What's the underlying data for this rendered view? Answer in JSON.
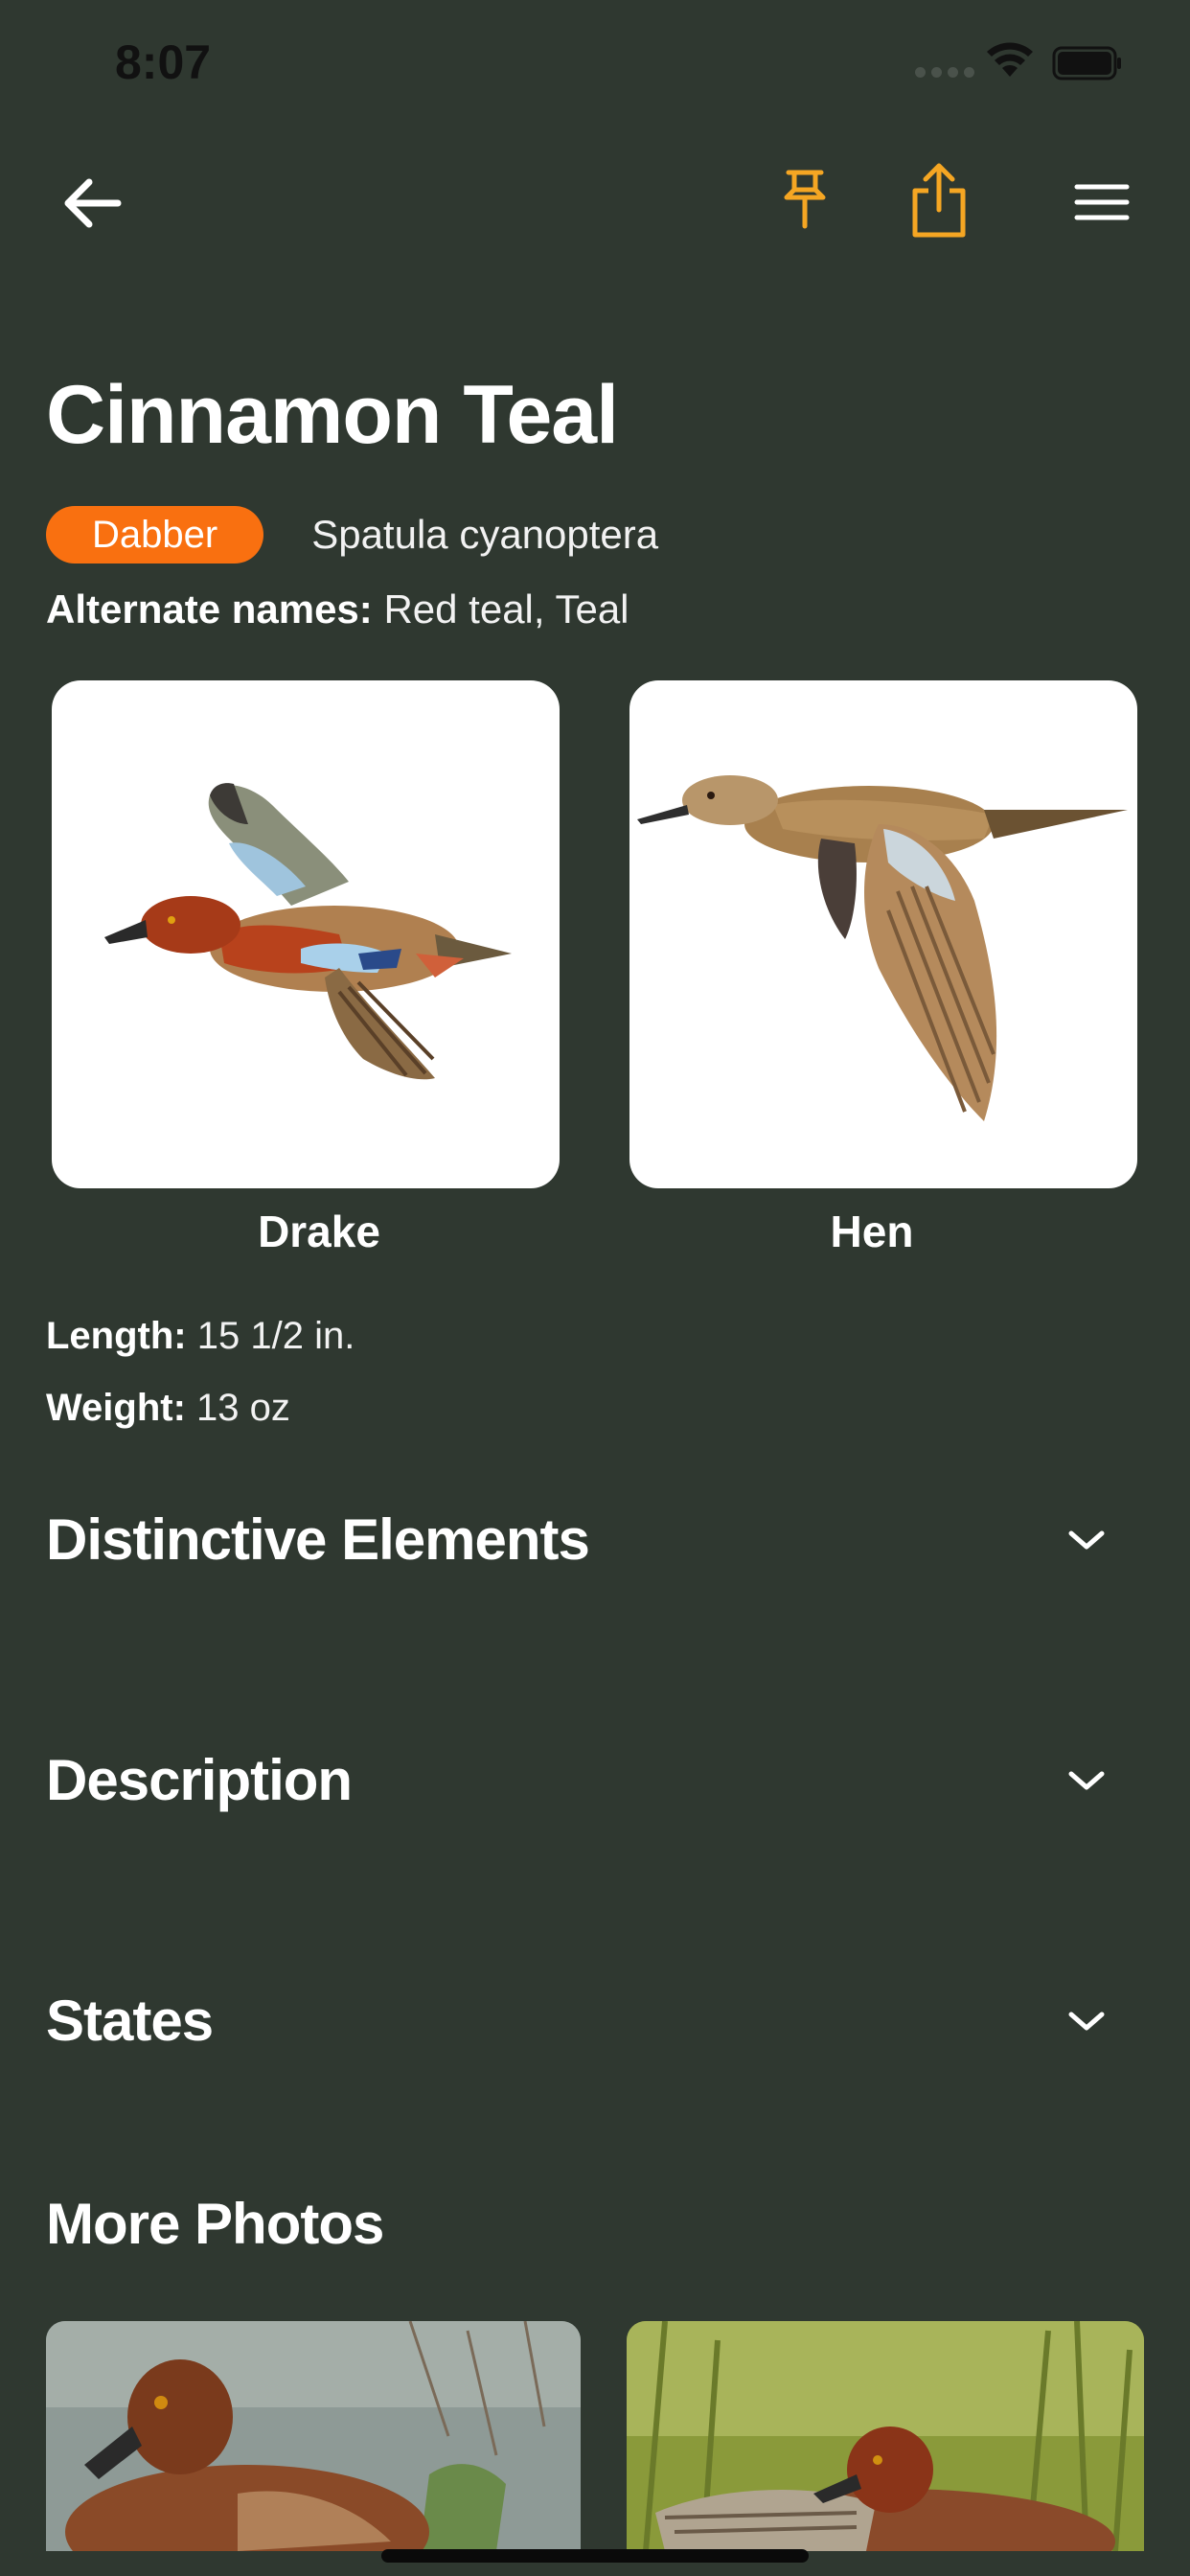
{
  "status_bar": {
    "time": "8:07"
  },
  "nav": {
    "back_icon": "arrow-left-icon",
    "pin_icon": "pushpin-icon",
    "share_icon": "share-icon",
    "menu_icon": "hamburger-menu-icon",
    "accent_color": "#f5a623"
  },
  "species": {
    "common_name": "Cinnamon Teal",
    "category": "Dabber",
    "category_color": "#f97010",
    "scientific_name": "Spatula cyanoptera",
    "alternate_names_label": "Alternate names:",
    "alternate_names": "Red teal, Teal"
  },
  "images": [
    {
      "caption": "Drake"
    },
    {
      "caption": "Hen"
    }
  ],
  "measurements": {
    "length_label": "Length:",
    "length_value": "15 1/2 in.",
    "weight_label": "Weight:",
    "weight_value": "13 oz"
  },
  "sections": [
    {
      "title": "Distinctive Elements",
      "icon": "chevron-down-icon"
    },
    {
      "title": "Description",
      "icon": "chevron-down-icon"
    },
    {
      "title": "States",
      "icon": "chevron-down-icon"
    }
  ],
  "more_photos": {
    "title": "More Photos"
  },
  "colors": {
    "background": "#2f3830",
    "text": "#ffffff"
  }
}
